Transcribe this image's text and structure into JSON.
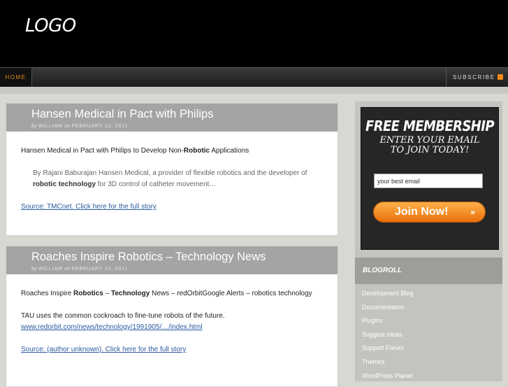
{
  "header": {
    "logo": "LOGO"
  },
  "nav": {
    "home": "HOME",
    "subscribe": "SUBSCRIBE"
  },
  "posts": [
    {
      "title": "Hansen Medical in Pact with Philips",
      "meta_by": "by",
      "author": "WILLIAM",
      "meta_on": "on",
      "date": "FEBRUARY 13, 2011",
      "intro_a": "Hansen Medical in Pact with Philips to Develop Non-",
      "intro_bold": "Robotic",
      "intro_b": " Applications",
      "quote_a": "By Rajani Baburajan Hansen Medical, a provider of flexible robotics and the developer of ",
      "quote_bold": "robotic technology",
      "quote_b": " for 3D control of catheter movement…",
      "source": "Source: TMCnet. Click here for the full story"
    },
    {
      "title": "Roaches Inspire Robotics – Technology News",
      "meta_by": "by",
      "author": "WILLIAM",
      "meta_on": "on",
      "date": "FEBRUARY 13, 2011",
      "intro_a": "Roaches Inspire ",
      "intro_bold1": "Robotics",
      "intro_mid": " – ",
      "intro_bold2": "Technology",
      "intro_b": " News – redOrbitGoogle Alerts – robotics technology",
      "text": "TAU uses the common cockroach to fine-tune robots of the future.",
      "url": "www.redorbit.com/news/technology/1991905/…/index.html",
      "source": "Source: (author unknown). Click here for the full story"
    }
  ],
  "sidebar": {
    "membership_title": "FREE MEMBERSHIP",
    "membership_line1": "ENTER YOUR EMAIL",
    "membership_line2": "TO JOIN TODAY!",
    "email_value": "your best email",
    "join_label": "Join Now!",
    "join_arrow": "»",
    "blogroll_title": "BLOGROLL",
    "blogroll": [
      "Development Blog",
      "Documentation",
      "Plugins",
      "Suggest Ideas",
      "Support Forum",
      "Themes",
      "WordPress Planet"
    ]
  }
}
